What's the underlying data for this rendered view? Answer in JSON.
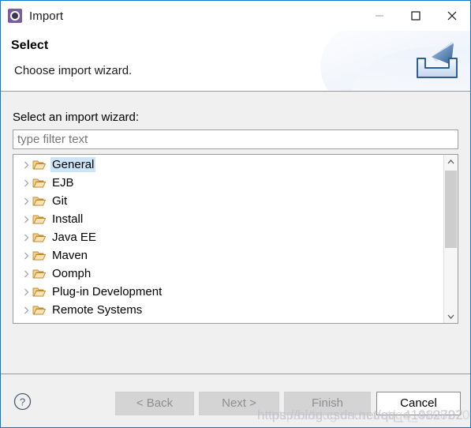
{
  "window": {
    "title": "Import",
    "icon": "eclipse-wizard-icon",
    "border_color": "#0a7ad1",
    "controls": [
      {
        "name": "minimize-button",
        "glyph": "minimize"
      },
      {
        "name": "maximize-button",
        "glyph": "maximize"
      },
      {
        "name": "close-button",
        "glyph": "close"
      }
    ]
  },
  "banner": {
    "title": "Select",
    "subtitle": "Choose import wizard.",
    "icon": "import-arrow-tray-icon"
  },
  "main": {
    "field_label": "Select an import wizard:",
    "filter": {
      "value": "",
      "placeholder": "type filter text"
    },
    "tree": {
      "selected": "General",
      "items": [
        {
          "label": "General",
          "icon": "folder-icon",
          "expandable": true,
          "selected": true
        },
        {
          "label": "EJB",
          "icon": "folder-icon",
          "expandable": true,
          "selected": false
        },
        {
          "label": "Git",
          "icon": "folder-icon",
          "expandable": true,
          "selected": false
        },
        {
          "label": "Install",
          "icon": "folder-icon",
          "expandable": true,
          "selected": false
        },
        {
          "label": "Java EE",
          "icon": "folder-icon",
          "expandable": true,
          "selected": false
        },
        {
          "label": "Maven",
          "icon": "folder-icon",
          "expandable": true,
          "selected": false
        },
        {
          "label": "Oomph",
          "icon": "folder-icon",
          "expandable": true,
          "selected": false
        },
        {
          "label": "Plug-in Development",
          "icon": "folder-icon",
          "expandable": true,
          "selected": false
        },
        {
          "label": "Remote Systems",
          "icon": "folder-icon",
          "expandable": true,
          "selected": false
        }
      ],
      "selection_color": "#cce4f7"
    }
  },
  "footer": {
    "help_icon": "help-circle-icon",
    "buttons": [
      {
        "name": "back-button",
        "label": "< Back",
        "enabled": false
      },
      {
        "name": "next-button",
        "label": "Next >",
        "enabled": false
      },
      {
        "name": "finish-button",
        "label": "Finish",
        "enabled": false
      },
      {
        "name": "cancel-button",
        "label": "Cancel",
        "enabled": true
      }
    ]
  },
  "watermark": {
    "text": "https://blog.csdn.net/qq_41982702"
  }
}
